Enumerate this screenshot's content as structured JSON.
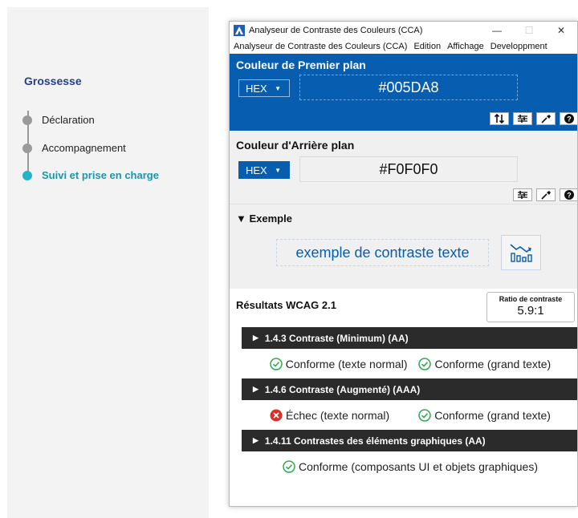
{
  "left_nav": {
    "title": "Grossesse",
    "steps": [
      {
        "label": "Déclaration",
        "active": false
      },
      {
        "label": "Accompagnement",
        "active": false
      },
      {
        "label": "Suivi et prise en charge",
        "active": true
      }
    ]
  },
  "window": {
    "title": "Analyseur de Contraste des Couleurs (CCA)",
    "menu": [
      "Analyseur de Contraste des Couleurs (CCA)",
      "Edition",
      "Affichage",
      "Developpment"
    ]
  },
  "foreground": {
    "heading": "Couleur de Premier plan",
    "format": "HEX",
    "value": "#005DA8"
  },
  "background": {
    "heading": "Couleur d'Arrière plan",
    "format": "HEX",
    "value": "#F0F0F0"
  },
  "example": {
    "heading": "▼ Exemple",
    "text": "exemple de contraste texte"
  },
  "results": {
    "heading": "Résultats WCAG 2.1",
    "ratio_label": "Ratio de contraste",
    "ratio_value": "5.9:1",
    "criteria": [
      {
        "title": "1.4.3 Contraste (Minimum) (AA)",
        "items": [
          {
            "status": "pass",
            "label": "Conforme (texte normal)"
          },
          {
            "status": "pass",
            "label": "Conforme (grand texte)"
          }
        ]
      },
      {
        "title": "1.4.6 Contraste (Augmenté) (AAA)",
        "items": [
          {
            "status": "fail",
            "label": "Échec (texte normal)"
          },
          {
            "status": "pass",
            "label": "Conforme (grand texte)"
          }
        ]
      },
      {
        "title": "1.4.11 Contrastes des éléments graphiques (AA)",
        "items": [
          {
            "status": "pass",
            "label": "Conforme (composants UI et objets graphiques)"
          }
        ]
      }
    ]
  },
  "colors": {
    "accent_blue": "#075DB0",
    "active_teal": "#23B4C7",
    "pass_green": "#2EAA4F",
    "fail_red": "#D9302C",
    "criterion_bar": "#2B2B2B"
  }
}
